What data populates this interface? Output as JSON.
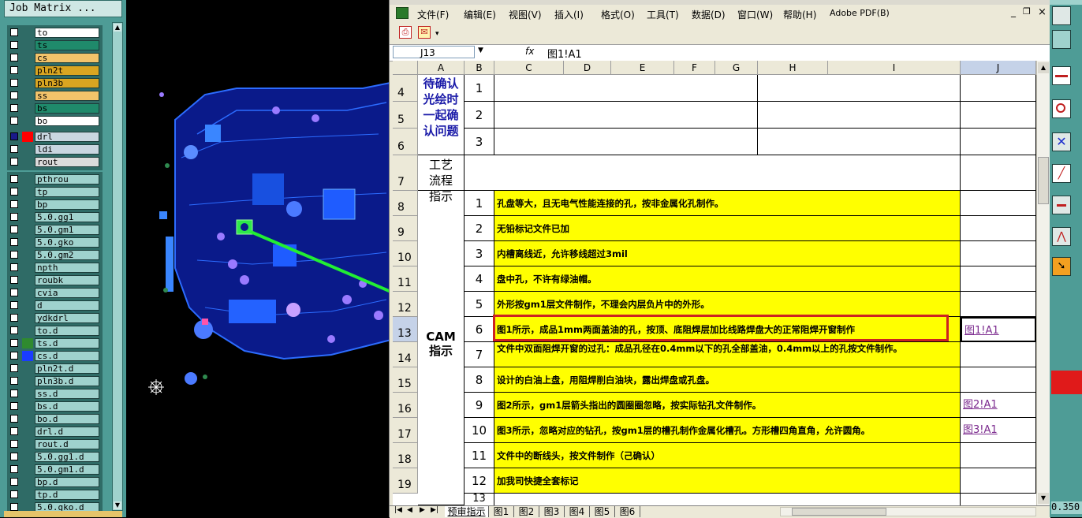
{
  "job_matrix": {
    "title": "Job Matrix ...",
    "groups": [
      {
        "layers": [
          {
            "name": "to",
            "color": "#ffffff"
          },
          {
            "name": "ts",
            "color": "#1f8a6b"
          },
          {
            "name": "cs",
            "color": "#f3c36a"
          },
          {
            "name": "pln2t",
            "color": "#d9a521"
          },
          {
            "name": "pln3b",
            "color": "#d9a521"
          },
          {
            "name": "ss",
            "color": "#f3c36a"
          },
          {
            "name": "bs",
            "color": "#1f8a6b"
          },
          {
            "name": "bo",
            "color": "#ffffff"
          }
        ]
      },
      {
        "layers": [
          {
            "name": "drl",
            "color": "#c9d6e0",
            "swatch": "#ff0000",
            "selected": true
          },
          {
            "name": "ldi",
            "color": "#c9d6e0"
          },
          {
            "name": "rout",
            "color": "#dcdcdc"
          }
        ]
      },
      {
        "layers": [
          {
            "name": "pthrou",
            "color": "#9fd2cd"
          },
          {
            "name": "tp",
            "color": "#9fd2cd"
          },
          {
            "name": "bp",
            "color": "#9fd2cd"
          },
          {
            "name": "5.0.gg1",
            "color": "#9fd2cd"
          },
          {
            "name": "5.0.gm1",
            "color": "#9fd2cd"
          },
          {
            "name": "5.0.gko",
            "color": "#9fd2cd"
          },
          {
            "name": "5.0.gm2",
            "color": "#9fd2cd"
          },
          {
            "name": "npth",
            "color": "#9fd2cd"
          },
          {
            "name": "roubk",
            "color": "#9fd2cd"
          },
          {
            "name": "cvia",
            "color": "#9fd2cd"
          },
          {
            "name": "d",
            "color": "#9fd2cd"
          },
          {
            "name": "ydkdrl",
            "color": "#9fd2cd"
          },
          {
            "name": "to.d",
            "color": "#9fd2cd"
          },
          {
            "name": "ts.d",
            "color": "#9fd2cd",
            "swatch": "#2f8a2f"
          },
          {
            "name": "cs.d",
            "color": "#9fd2cd",
            "swatch": "#1a3cff"
          },
          {
            "name": "pln2t.d",
            "color": "#9fd2cd"
          },
          {
            "name": "pln3b.d",
            "color": "#9fd2cd"
          },
          {
            "name": "ss.d",
            "color": "#9fd2cd"
          },
          {
            "name": "bs.d",
            "color": "#9fd2cd"
          },
          {
            "name": "bo.d",
            "color": "#9fd2cd"
          },
          {
            "name": "drl.d",
            "color": "#9fd2cd"
          },
          {
            "name": "rout.d",
            "color": "#9fd2cd"
          },
          {
            "name": "5.0.gg1.d",
            "color": "#9fd2cd"
          },
          {
            "name": "5.0.gm1.d",
            "color": "#9fd2cd"
          },
          {
            "name": "bp.d",
            "color": "#9fd2cd"
          },
          {
            "name": "tp.d",
            "color": "#9fd2cd"
          },
          {
            "name": "5.0.gko.d",
            "color": "#9fd2cd"
          }
        ]
      }
    ]
  },
  "excel": {
    "menu": [
      "文件(F)",
      "编辑(E)",
      "视图(V)",
      "插入(I)",
      "格式(O)",
      "工具(T)",
      "数据(D)",
      "窗口(W)",
      "帮助(H)",
      "Adobe PDF(B)"
    ],
    "name_box": "J13",
    "fx": "fx",
    "formula": "图1!A1",
    "columns": [
      "A",
      "B",
      "C",
      "D",
      "E",
      "F",
      "G",
      "H",
      "I",
      "J"
    ],
    "section_confirm": "待确认光绘时一起确认问题",
    "confirm_rows": [
      "1",
      "2",
      "3"
    ],
    "section_process": "工艺流程指示",
    "section_cam": "CAM指示",
    "row_numbers": [
      "4",
      "5",
      "6",
      "7",
      "8",
      "9",
      "10",
      "11",
      "12",
      "13",
      "14",
      "15",
      "16",
      "17",
      "18",
      "19"
    ],
    "cam_items": [
      {
        "no": "1",
        "text": "孔盘等大，且无电气性能连接的孔，按非金属化孔制作。",
        "link": ""
      },
      {
        "no": "2",
        "text": "无铅标记文件已加",
        "link": ""
      },
      {
        "no": "3",
        "text": "内槽离线近，允许移线超过3mil",
        "link": ""
      },
      {
        "no": "4",
        "text": "盘中孔，不许有绿油帽。",
        "link": ""
      },
      {
        "no": "5",
        "text": "外形按gm1层文件制作，不理会内层负片中的外形。",
        "link": ""
      },
      {
        "no": "6",
        "text": "图1所示，成品1mm两面盖油的孔，按顶、底阻焊层加比线路焊盘大的正常阻焊开窗制作",
        "link": "图1!A1"
      },
      {
        "no": "7",
        "text": "文件中双面阻焊开窗的过孔：成品孔径在0.4mm以下的孔全部盖油，0.4mm以上的孔按文件制作。",
        "link": ""
      },
      {
        "no": "8",
        "text": "设计的白油上盘，用阻焊削白油块，露出焊盘或孔盘。",
        "link": ""
      },
      {
        "no": "9",
        "text": "图2所示，gm1层箭头指出的圆圈圈忽略，按实际钻孔文件制作。",
        "link": "图2!A1"
      },
      {
        "no": "10",
        "text": "图3所示，忽略对应的钻孔，按gm1层的槽孔制作金属化槽孔。方形槽四角直角，允许圆角。",
        "link": "图3!A1"
      },
      {
        "no": "11",
        "text": "文件中的断线头，按文件制作（己确认）",
        "link": ""
      },
      {
        "no": "12",
        "text": "加我司快捷全套标记",
        "link": ""
      }
    ],
    "next_no": "13",
    "sheet_tabs": [
      "预审指示",
      "图1",
      "图2",
      "图3",
      "图4",
      "图5",
      "图6"
    ],
    "status_value": "0.350",
    "highlight_color": "#ffff00",
    "annotation_color": "#cc2222",
    "arrow_color": "#22ee33"
  }
}
